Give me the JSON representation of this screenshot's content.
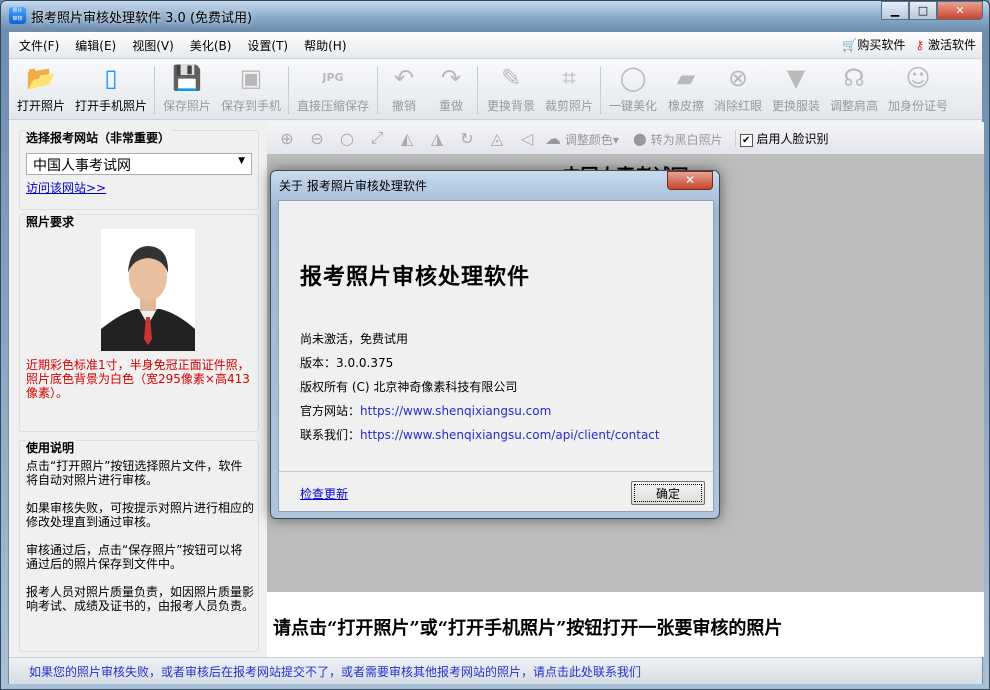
{
  "window": {
    "title": "报考照片审核处理软件 3.0 (免费试用)",
    "icon_text": "照片审核"
  },
  "menu": [
    "文件(F)",
    "编辑(E)",
    "视图(V)",
    "美化(B)",
    "设置(T)",
    "帮助(H)"
  ],
  "menu_right": {
    "buy": "购买软件",
    "activate": "激活软件"
  },
  "toolbar": [
    {
      "label": "打开照片",
      "icon": "open-folder-icon",
      "enabled": true
    },
    {
      "label": "打开手机照片",
      "icon": "phone-icon",
      "enabled": true
    },
    {
      "label": "保存照片",
      "icon": "save-icon",
      "enabled": false
    },
    {
      "label": "保存到手机",
      "icon": "save-phone-icon",
      "enabled": false
    },
    {
      "label": "直接压缩保存",
      "icon": "jpg-file-icon",
      "enabled": false
    },
    {
      "label": "撤销",
      "icon": "undo-icon",
      "enabled": false
    },
    {
      "label": "重做",
      "icon": "redo-icon",
      "enabled": false
    },
    {
      "label": "更换背景",
      "icon": "brush-icon",
      "enabled": false
    },
    {
      "label": "裁剪照片",
      "icon": "crop-icon",
      "enabled": false
    },
    {
      "label": "一键美化",
      "icon": "ring-icon",
      "enabled": false
    },
    {
      "label": "橡皮擦",
      "icon": "eraser-icon",
      "enabled": false
    },
    {
      "label": "消除红眼",
      "icon": "red-eye-icon",
      "enabled": false
    },
    {
      "label": "更换服装",
      "icon": "suit-icon",
      "enabled": false
    },
    {
      "label": "调整肩高",
      "icon": "shoulder-icon",
      "enabled": false
    },
    {
      "label": "加身份证号",
      "icon": "person-id-icon",
      "enabled": false
    }
  ],
  "left": {
    "site_title": "选择报考网站（非常重要）",
    "site_selected": "中国人事考试网",
    "visit_link": "访问该网站>>",
    "req_title": "照片要求",
    "req_text": "近期彩色标准1寸，半身免冠正面证件照，照片底色背景为白色（宽295像素×高413像素）。",
    "usage_title": "使用说明",
    "usage": [
      "点击“打开照片”按钮选择照片文件，软件将自动对照片进行审核。",
      "如果审核失败，可按提示对照片进行相应的修改处理直到通过审核。",
      "审核通过后，点击“保存照片”按钮可以将通过后的照片保存到文件中。",
      "报考人员对照片质量负责，如因照片质量影响考试、成绩及证书的，由报考人员负责。"
    ]
  },
  "toolbar2": {
    "adjust_color": "调整颜色",
    "grayscale": "转为黑白照片",
    "face_detect": "启用人脸识别",
    "face_detect_checked": true
  },
  "canvas": {
    "heading": "中国人事考试网",
    "hint": "请点击“打开照片”或“打开手机照片”按钮打开一张要审核的照片"
  },
  "status": "如果您的照片审核失败，或者审核后在报考网站提交不了，或者需要审核其他报考网站的照片，请点击此处联系我们",
  "dialog": {
    "title": "关于 报考照片审核处理软件",
    "product": "报考照片审核处理软件",
    "trial": "尚未激活，免费试用",
    "version_label": "版本：",
    "version": "3.0.0.375",
    "copyright": "版权所有 (C) 北京神奇像素科技有限公司",
    "site_label": "官方网站：",
    "site_url": "https://www.shenqixiangsu.com",
    "contact_label": "联系我们：",
    "contact_url": "https://www.shenqixiangsu.com/api/client/contact",
    "check_update": "检查更新",
    "ok": "确定"
  }
}
